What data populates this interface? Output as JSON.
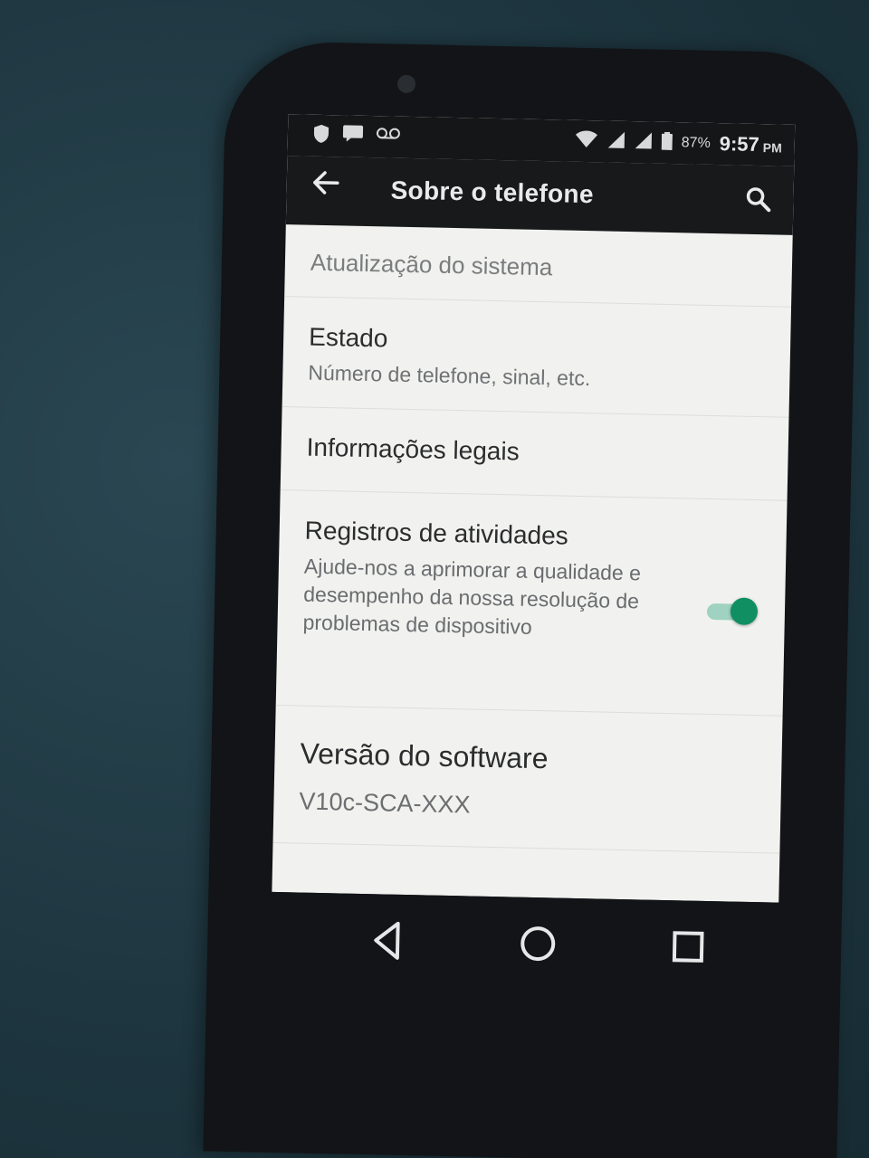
{
  "status_bar": {
    "battery": "87%",
    "time": "9:57",
    "ampm": "PM",
    "icons": [
      "shield-icon",
      "message-icon",
      "voicemail-icon",
      "wifi-icon",
      "signal-icon",
      "signal-icon",
      "battery-icon"
    ]
  },
  "app_bar": {
    "title": "Sobre o telefone",
    "back_icon": "arrow-back-icon",
    "search_icon": "search-icon"
  },
  "settings": {
    "items": [
      {
        "title": "Atualização do sistema",
        "subtitle": ""
      },
      {
        "title": "Estado",
        "subtitle": "Número de telefone, sinal, etc."
      },
      {
        "title": "Informações legais",
        "subtitle": ""
      },
      {
        "title": "Registros de atividades",
        "subtitle": "Ajude-nos a aprimorar a qualidade e desempenho da nossa resolução de problemas de dispositivo",
        "toggle_on": true
      },
      {
        "title": "Versão do software",
        "subtitle": "V10c-SCA-XXX"
      }
    ]
  },
  "nav_bar": {
    "icons": [
      "nav-back-icon",
      "nav-home-icon",
      "nav-recents-icon"
    ]
  },
  "colors": {
    "accent": "#0f8f62",
    "screen_bg": "#f1f2ef",
    "bar_bg": "#17191b"
  }
}
